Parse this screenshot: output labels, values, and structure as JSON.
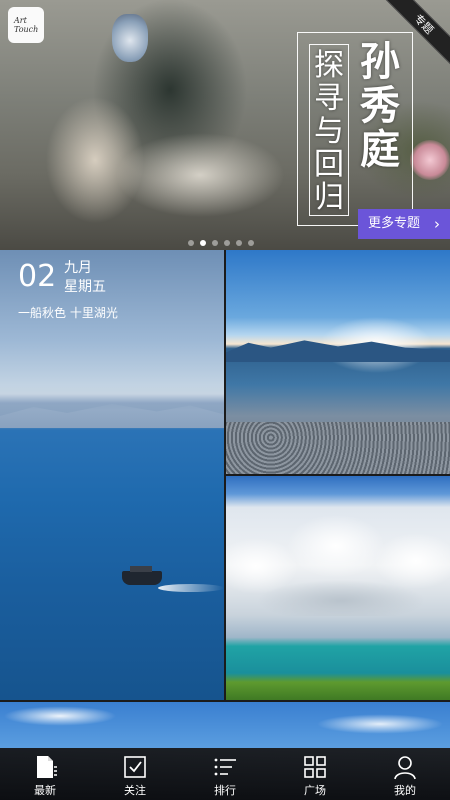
{
  "app": {
    "logo_text": "Art Touch"
  },
  "banner": {
    "ribbon": "专题",
    "title_main": "孙秀庭",
    "title_sub": "探寻与回归",
    "more_button": "更多专题",
    "page_count": 6,
    "active_page_index": 1
  },
  "daily": {
    "day": "02",
    "month": "九月",
    "weekday": "星期五",
    "quote": "一船秋色 十里湖光"
  },
  "nav": {
    "items": [
      {
        "label": "最新",
        "icon": "newest-icon",
        "active": true
      },
      {
        "label": "关注",
        "icon": "follow-icon",
        "active": false
      },
      {
        "label": "排行",
        "icon": "ranking-icon",
        "active": false
      },
      {
        "label": "广场",
        "icon": "square-icon",
        "active": false
      },
      {
        "label": "我的",
        "icon": "profile-icon",
        "active": false
      }
    ]
  }
}
